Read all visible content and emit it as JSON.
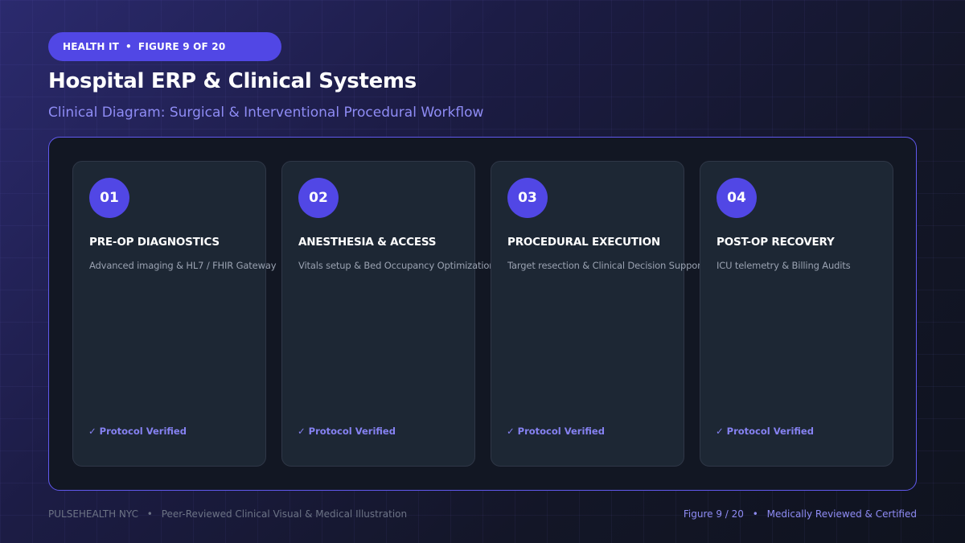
{
  "header": {
    "category": "HEALTH IT",
    "separator": "•",
    "figure_label": "FIGURE 9 OF 20",
    "title": "Hospital ERP & Clinical Systems",
    "subtitle": "Clinical Diagram: Surgical & Interventional Procedural Workflow"
  },
  "steps": [
    {
      "number": "01",
      "title": "PRE-OP DIAGNOSTICS",
      "description": "Advanced imaging & HL7 / FHIR Gateway",
      "status": "✓ Protocol Verified"
    },
    {
      "number": "02",
      "title": "ANESTHESIA & ACCESS",
      "description": "Vitals setup & Bed Occupancy Optimization",
      "status": "✓ Protocol Verified"
    },
    {
      "number": "03",
      "title": "PROCEDURAL EXECUTION",
      "description": "Target resection & Clinical Decision Support",
      "status": "✓ Protocol Verified"
    },
    {
      "number": "04",
      "title": "POST-OP RECOVERY",
      "description": "ICU telemetry & Billing Audits",
      "status": "✓ Protocol Verified"
    }
  ],
  "footer": {
    "brand": "PULSEHEALTH NYC",
    "separator": "•",
    "tagline": "Peer-Reviewed Clinical Visual & Medical Illustration",
    "figure_index": "Figure 9 / 20",
    "certification": "Medically Reviewed & Certified"
  },
  "colors": {
    "accent": "#5147e5",
    "accent_text": "#8f8cf5",
    "card_background": "#1d2734",
    "panel_border": "#6159ee"
  }
}
